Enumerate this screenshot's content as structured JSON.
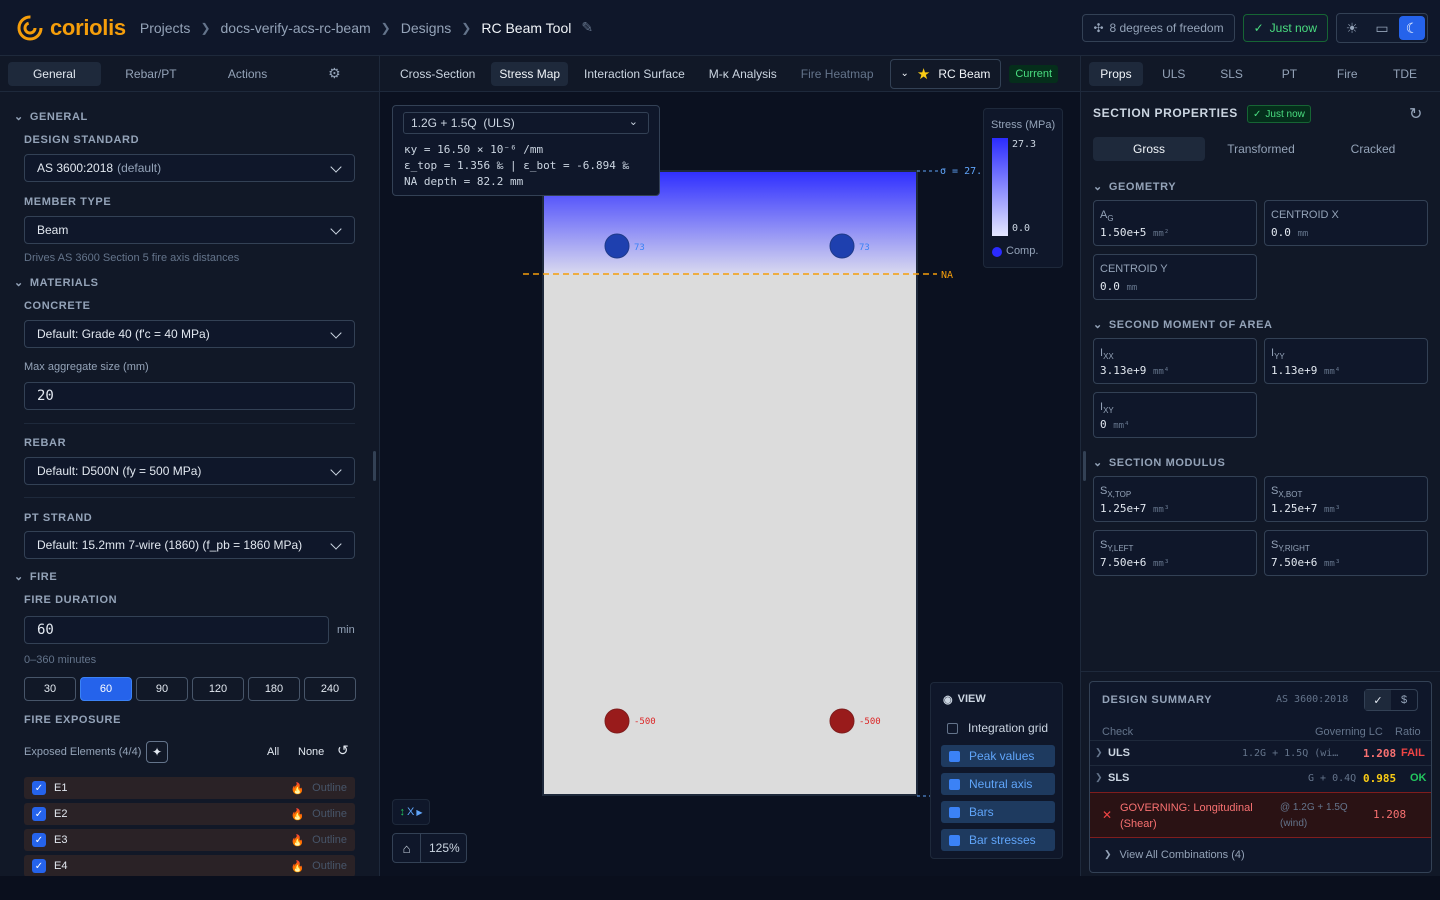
{
  "header": {
    "logo_text": "coriolis",
    "breadcrumbs": [
      "Projects",
      "docs-verify-acs-rc-beam",
      "Designs",
      "RC Beam Tool"
    ],
    "dof": "8 degrees of freedom",
    "saved": "Just now",
    "colors": {
      "brand": "#f59e0b",
      "accent": "#2563eb"
    }
  },
  "left": {
    "tabs": [
      "General",
      "Rebar/PT",
      "Actions"
    ],
    "general_section": "GENERAL",
    "design_standard_label": "DESIGN STANDARD",
    "design_standard_value": "AS 3600:2018",
    "design_standard_suffix": "(default)",
    "member_type_label": "MEMBER TYPE",
    "member_type_value": "Beam",
    "member_type_hint": "Drives AS 3600 Section 5 fire axis distances",
    "materials_section": "MATERIALS",
    "concrete_label": "CONCRETE",
    "concrete_value": "Default: Grade 40 (f'c = 40 MPa)",
    "agg_label": "Max aggregate size (mm)",
    "agg_value": "20",
    "rebar_label": "REBAR",
    "rebar_value": "Default: D500N (fy = 500 MPa)",
    "pt_label": "PT STRAND",
    "pt_value": "Default: 15.2mm 7-wire (1860) (f_pb = 1860 MPa)",
    "fire_section": "FIRE",
    "fire_duration_label": "FIRE DURATION",
    "fire_duration_value": "60",
    "fire_duration_unit": "min",
    "fire_duration_hint": "0–360 minutes",
    "durations": [
      "30",
      "60",
      "90",
      "120",
      "180",
      "240"
    ],
    "fire_exposure_label": "FIRE EXPOSURE",
    "exposed_label": "Exposed Elements (4/4)",
    "all_label": "All",
    "none_label": "None",
    "elements": [
      {
        "name": "E1",
        "mode": "Outline"
      },
      {
        "name": "E2",
        "mode": "Outline"
      },
      {
        "name": "E3",
        "mode": "Outline"
      },
      {
        "name": "E4",
        "mode": "Outline"
      }
    ]
  },
  "center": {
    "tabs": [
      "Cross-Section",
      "Stress Map",
      "Interaction Surface",
      "M-κ Analysis",
      "Fire Heatmap"
    ],
    "design_name": "RC Beam",
    "current_badge": "Current",
    "load_case": "1.2G + 1.5Q  (ULS)",
    "kappa_line": "κy = 16.50 × 10⁻⁶ /mm",
    "strain_line": "ε_top = 1.356 ‰ | ε_bot = -6.894 ‰",
    "na_line": "NA depth = 82.2 mm",
    "sigma_label": "σ = 27.",
    "na_label": "NA",
    "legend_title": "Stress (MPa)",
    "legend_max": "27.3",
    "legend_min": "0.0",
    "legend_comp": "Comp.",
    "bar_top_label": "73",
    "bar_bot_label": "-500",
    "axis_label": "X",
    "zoom": "125%",
    "view_title": "VIEW",
    "view_items": [
      {
        "label": "Integration grid",
        "on": false
      },
      {
        "label": "Peak values",
        "on": true
      },
      {
        "label": "Neutral axis",
        "on": true
      },
      {
        "label": "Bars",
        "on": true
      },
      {
        "label": "Bar stresses",
        "on": true
      }
    ]
  },
  "right": {
    "tabs": [
      "Props",
      "ULS",
      "SLS",
      "PT",
      "Fire",
      "TDE"
    ],
    "title": "SECTION PROPERTIES",
    "badge": "Just now",
    "prop_tabs": [
      "Gross",
      "Transformed",
      "Cracked"
    ],
    "geometry": "GEOMETRY",
    "ag_label": "A",
    "ag_sub": "G",
    "ag_value": "1.50e+5",
    "ag_unit": "mm²",
    "cx_label": "CENTROID X",
    "cx_value": "0.0",
    "cx_unit": "mm",
    "cy_label": "CENTROID Y",
    "cy_value": "0.0",
    "cy_unit": "mm",
    "moa": "SECOND MOMENT OF AREA",
    "ixx_label": "I",
    "ixx_sub": "XX",
    "ixx_value": "3.13e+9",
    "iyy_label": "I",
    "iyy_sub": "YY",
    "iyy_value": "1.13e+9",
    "ixy_label": "I",
    "ixy_sub": "XY",
    "ixy_value": "0",
    "i_unit": "mm⁴",
    "modulus": "SECTION MODULUS",
    "sxt_label": "S",
    "sxt_sub": "X,TOP",
    "sxt_value": "1.25e+7",
    "sxb_label": "S",
    "sxb_sub": "X,BOT",
    "sxb_value": "1.25e+7",
    "syl_label": "S",
    "syl_sub": "Y,LEFT",
    "syl_value": "7.50e+6",
    "syr_label": "S",
    "syr_sub": "Y,RIGHT",
    "syr_value": "7.50e+6",
    "s_unit": "mm³",
    "summary_title": "DESIGN SUMMARY",
    "summary_std": "AS 3600:2018",
    "col_check": "Check",
    "col_lc": "Governing LC",
    "col_ratio": "Ratio",
    "uls_name": "ULS",
    "uls_lc": "1.2G + 1.5Q (wi…",
    "uls_ratio": "1.208",
    "uls_status": "FAIL",
    "sls_name": "SLS",
    "sls_lc": "G + 0.4Q",
    "sls_ratio": "0.985",
    "sls_status": "OK",
    "gov_text": "GOVERNING: Longitudinal (Shear)",
    "gov_lc": "@ 1.2G + 1.5Q (wind)",
    "gov_ratio": "1.208",
    "view_all": "View All Combinations (4)"
  }
}
